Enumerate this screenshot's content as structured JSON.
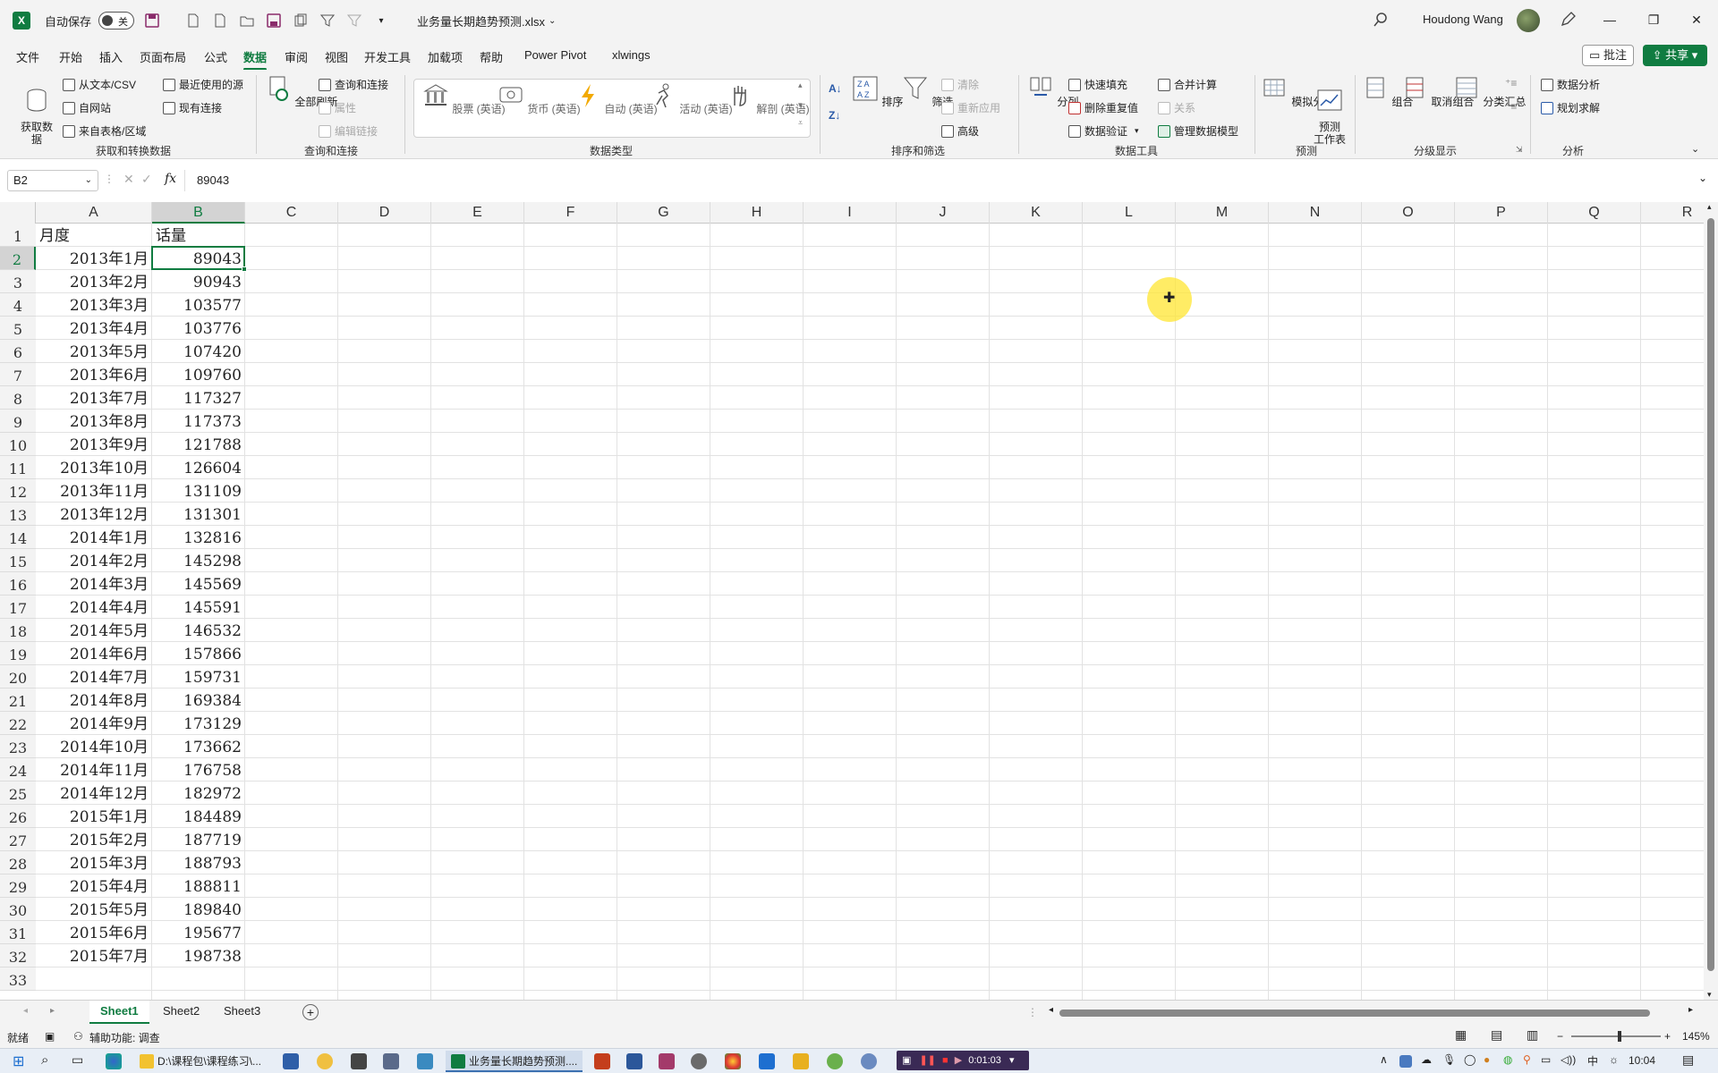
{
  "titlebar": {
    "autosave_label": "自动保存",
    "autosave_state": "关",
    "document_title": "业务量长期趋势预测.xlsx",
    "user_name": "Houdong Wang"
  },
  "menu": {
    "tabs": [
      "文件",
      "开始",
      "插入",
      "页面布局",
      "公式",
      "数据",
      "审阅",
      "视图",
      "开发工具",
      "加载项",
      "帮助",
      "Power Pivot",
      "xlwings"
    ],
    "active_tab": "数据",
    "comment_label": "批注",
    "share_label": "共享"
  },
  "ribbon": {
    "get_data": "获取数\n据",
    "from_text_csv": "从文本/CSV",
    "from_web": "自网站",
    "from_table": "来自表格/区域",
    "recent_sources": "最近使用的源",
    "existing_connections": "现有连接",
    "group_get_transform": "获取和转换数据",
    "refresh_all": "全部刷新",
    "queries_connections": "查询和连接",
    "properties": "属性",
    "edit_links": "编辑链接",
    "group_queries": "查询和连接",
    "data_types": [
      "股票 (英语)",
      "货币 (英语)",
      "自动 (英语)",
      "活动 (英语)",
      "解剖 (英语)"
    ],
    "group_data_types": "数据类型",
    "sort": "排序",
    "filter": "筛选",
    "clear": "清除",
    "reapply": "重新应用",
    "advanced": "高级",
    "group_sort_filter": "排序和筛选",
    "text_to_columns": "分列",
    "flash_fill": "快速填充",
    "remove_duplicates": "删除重复值",
    "data_validation": "数据验证",
    "consolidate": "合并计算",
    "relationships": "关系",
    "manage_data_model": "管理数据模型",
    "group_data_tools": "数据工具",
    "what_if": "模拟分析",
    "forecast_sheet": "预测\n工作表",
    "group_forecast": "预测",
    "group": "组合",
    "ungroup": "取消组合",
    "subtotal": "分类汇总",
    "group_outline": "分级显示",
    "data_analysis": "数据分析",
    "solver": "规划求解",
    "group_analysis": "分析"
  },
  "formula_bar": {
    "name_box": "B2",
    "fx": "fx",
    "content": "89043"
  },
  "columns": [
    "A",
    "B",
    "C",
    "D",
    "E",
    "F",
    "G",
    "H",
    "I",
    "J",
    "K",
    "L",
    "M",
    "N",
    "O",
    "P",
    "Q",
    "R"
  ],
  "selected_column": "B",
  "selected_row": 2,
  "rows": [
    [
      "月度",
      "话量"
    ],
    [
      "2013年1月",
      "89043"
    ],
    [
      "2013年2月",
      "90943"
    ],
    [
      "2013年3月",
      "103577"
    ],
    [
      "2013年4月",
      "103776"
    ],
    [
      "2013年5月",
      "107420"
    ],
    [
      "2013年6月",
      "109760"
    ],
    [
      "2013年7月",
      "117327"
    ],
    [
      "2013年8月",
      "117373"
    ],
    [
      "2013年9月",
      "121788"
    ],
    [
      "2013年10月",
      "126604"
    ],
    [
      "2013年11月",
      "131109"
    ],
    [
      "2013年12月",
      "131301"
    ],
    [
      "2014年1月",
      "132816"
    ],
    [
      "2014年2月",
      "145298"
    ],
    [
      "2014年3月",
      "145569"
    ],
    [
      "2014年4月",
      "145591"
    ],
    [
      "2014年5月",
      "146532"
    ],
    [
      "2014年6月",
      "157866"
    ],
    [
      "2014年7月",
      "159731"
    ],
    [
      "2014年8月",
      "169384"
    ],
    [
      "2014年9月",
      "173129"
    ],
    [
      "2014年10月",
      "173662"
    ],
    [
      "2014年11月",
      "176758"
    ],
    [
      "2014年12月",
      "182972"
    ],
    [
      "2015年1月",
      "184489"
    ],
    [
      "2015年2月",
      "187719"
    ],
    [
      "2015年3月",
      "188793"
    ],
    [
      "2015年4月",
      "188811"
    ],
    [
      "2015年5月",
      "189840"
    ],
    [
      "2015年6月",
      "195677"
    ],
    [
      "2015年7月",
      "198738"
    ],
    [
      "",
      ""
    ]
  ],
  "sheets": [
    "Sheet1",
    "Sheet2",
    "Sheet3"
  ],
  "active_sheet": "Sheet1",
  "statusbar": {
    "ready": "就绪",
    "accessibility": "辅助功能: 调查",
    "zoom": "145%"
  },
  "taskbar": {
    "explorer_window": "D:\\课程包\\课程练习\\...",
    "excel_window": "业务量长期趋势预测....",
    "recording_time": "0:01:03",
    "ime": "中",
    "clock": "10:04"
  },
  "colors": {
    "excel_green": "#107c41",
    "cursor_highlight": "#ffe632"
  }
}
